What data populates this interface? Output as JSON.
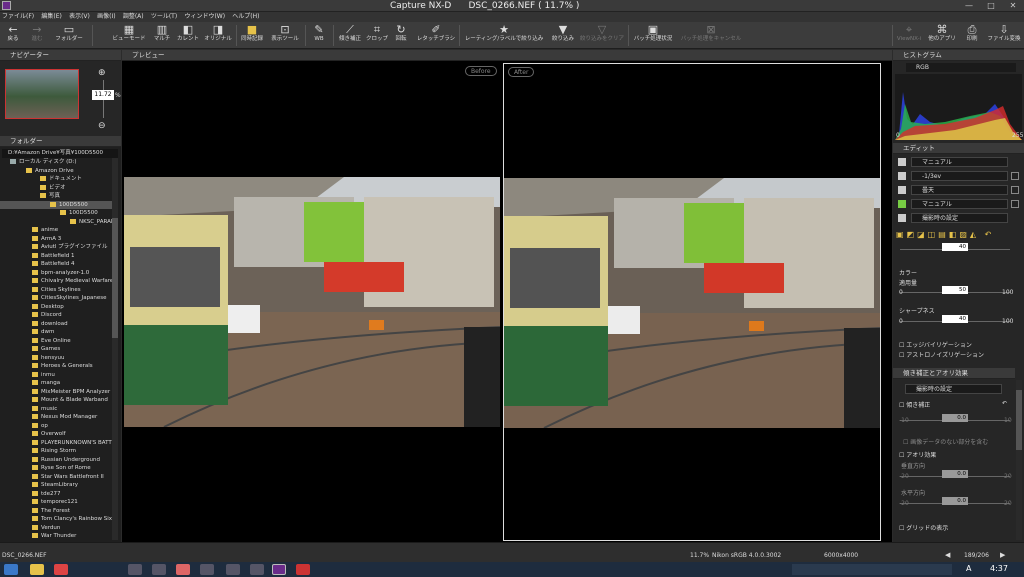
{
  "titlebar": {
    "title": "Capture NX-D      DSC_0266.NEF ( 11.7% )"
  },
  "menu": [
    "ファイル(F)",
    "編集(E)",
    "表示(V)",
    "画像(I)",
    "調整(A)",
    "ツール(T)",
    "ウィンドウ(W)",
    "ヘルプ(H)"
  ],
  "toolbar": {
    "back": "戻る",
    "forward": "進む",
    "folder": "フォルダー",
    "viewmode": "ビューモード",
    "multi": "マルチ",
    "current": "カレント",
    "original": "オリジナル",
    "compare": "同時記録",
    "display_tool": "表示ツール",
    "wb": "WB",
    "straighten": "傾き補正",
    "crop": "クロップ",
    "rotate": "回転",
    "retouch": "レタッチブラシ",
    "rating": "レーティング/ラベルで絞り込み",
    "filter": "絞り込み",
    "clear_filter": "絞り込みをクリア",
    "batch_status": "バッチ処理状況",
    "batch_cancel": "バッチ処理をキャンセル",
    "viewnx": "ViewNX-i",
    "other_app": "他のアプリ",
    "print": "印刷",
    "convert": "ファイル変換"
  },
  "navigator": {
    "title": "ナビゲーター",
    "zoom": "11.72",
    "zoom_unit": "%"
  },
  "folder": {
    "title": "フォルダー",
    "path": "D:¥Amazon Drive¥写真¥100D5500",
    "items": [
      "ローカル ディスク (D:)",
      "Amazon Drive",
      "ドキュメント",
      "ビデオ",
      "写真",
      "100D5500",
      "100D5500",
      "NKSC_PARAM",
      "anime",
      "ArmA 3",
      "Aviutl プラグインファイル",
      "Battlefield 1",
      "Battlefield 4",
      "bpm-analyzer-1.0",
      "Chivalry Medieval Warfare",
      "Cities Skylines",
      "CitiesSkylines_Japanese",
      "Desktop",
      "Discord",
      "download",
      "dwm",
      "Eve Online",
      "Games",
      "hensyuu",
      "Heroes & Generals",
      "inmu",
      "manga",
      "MixMeister BPM Analyzer",
      "Mount & Blade Warband",
      "music",
      "Nexus Mod Manager",
      "op",
      "Overwolf",
      "PLAYERUNKNOWN'S BATTLEGROUNDS",
      "Rising Storm",
      "Russian Underground",
      "Ryse Son of Rome",
      "Star Wars Battlefront II",
      "SteamLibrary",
      "tde277",
      "temporec121",
      "The Forest",
      "Tom Clancy's Rainbow Six Siege",
      "Verdun",
      "War Thunder"
    ]
  },
  "preview": {
    "title": "プレビュー",
    "before": "Before",
    "after": "After"
  },
  "histogram": {
    "title": "ヒストグラム",
    "channel": "RGB",
    "min": "0",
    "max": "255"
  },
  "edit": {
    "title": "エディット",
    "rows": [
      {
        "value": "マニュアル"
      },
      {
        "value": "-1/3ev"
      },
      {
        "value": "曇天"
      },
      {
        "value": "マニュアル"
      },
      {
        "value": "撮影時の設定"
      }
    ],
    "color_label": "カラー",
    "saturation_label": "適用量",
    "saturation_value": "50",
    "sharpness_label": "シャープネス",
    "sharpness_value": "40",
    "top_value": "40",
    "min0": "0",
    "max100": "100",
    "edge_label": "エッジバイリゲーション",
    "astro_label": "アストロノイズリゲーション"
  },
  "lens": {
    "title": "傾き補正とアオリ効果",
    "preset": "撮影時の設定",
    "tilt_label": "傾き補正",
    "tilt_value": "0.0",
    "tilt_min": "-10",
    "tilt_max": "10",
    "keep_label": "画像データのない部分を含む",
    "aori_label": "アオリ効果",
    "vertical_label": "垂直方向",
    "vertical_value": "0.0",
    "horizontal_label": "水平方向",
    "horizontal_value": "0.0",
    "min20": "-20",
    "max20": "20",
    "grid_label": "グリッドの表示"
  },
  "status": {
    "filename": "DSC_0266.NEF",
    "zoom": "11.7%",
    "profile": "Nikon sRGB 4.0.0.3002",
    "size": "6000x4000",
    "counter": "189/206"
  },
  "taskbar": {
    "time": "4:37",
    "ime": "A"
  },
  "colors": {
    "bg": "#2b2b2b",
    "accent": "#e6c24a"
  }
}
